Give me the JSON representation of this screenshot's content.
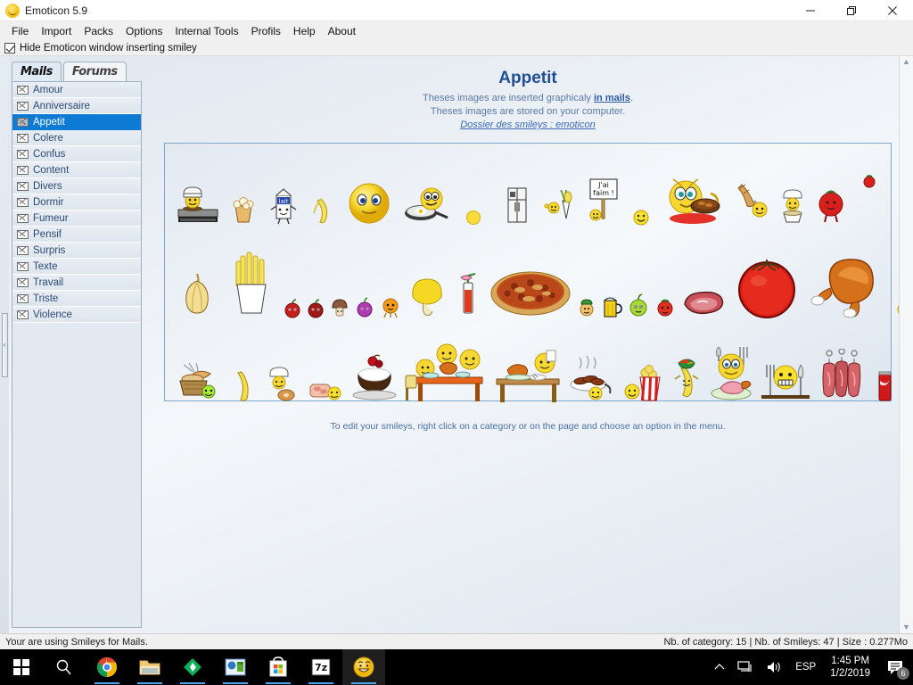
{
  "window": {
    "title": "Emoticon 5.9",
    "app_icon": "smiley-icon",
    "minimize_label": "Minimize",
    "restore_label": "Restore",
    "close_label": "Close"
  },
  "menu": {
    "items": [
      {
        "label": "File"
      },
      {
        "label": "Import"
      },
      {
        "label": "Packs"
      },
      {
        "label": "Options"
      },
      {
        "label": "Internal Tools"
      },
      {
        "label": "Profils"
      },
      {
        "label": "Help"
      },
      {
        "label": "About"
      }
    ]
  },
  "options_strip": {
    "hide_window_checkbox": {
      "label": "Hide Emoticon window inserting smiley",
      "checked": true
    }
  },
  "sidebar": {
    "collapse_handle": "‹",
    "tabs": [
      {
        "label": "Mails",
        "active": true
      },
      {
        "label": "Forums",
        "active": false
      }
    ],
    "categories": [
      {
        "label": "Amour",
        "icon": "envelope-icon",
        "selected": false
      },
      {
        "label": "Anniversaire",
        "icon": "envelope-icon",
        "selected": false
      },
      {
        "label": "Appetit",
        "icon": "envelope-icon",
        "selected": true
      },
      {
        "label": "Colere",
        "icon": "envelope-icon",
        "selected": false
      },
      {
        "label": "Confus",
        "icon": "envelope-icon",
        "selected": false
      },
      {
        "label": "Content",
        "icon": "envelope-icon",
        "selected": false
      },
      {
        "label": "Divers",
        "icon": "envelope-icon",
        "selected": false
      },
      {
        "label": "Dormir",
        "icon": "envelope-icon",
        "selected": false
      },
      {
        "label": "Fumeur",
        "icon": "envelope-icon",
        "selected": false
      },
      {
        "label": "Pensif",
        "icon": "envelope-icon",
        "selected": false
      },
      {
        "label": "Surpris",
        "icon": "envelope-icon",
        "selected": false
      },
      {
        "label": "Texte",
        "icon": "envelope-icon",
        "selected": false
      },
      {
        "label": "Travail",
        "icon": "envelope-icon",
        "selected": false
      },
      {
        "label": "Triste",
        "icon": "envelope-icon",
        "selected": false
      },
      {
        "label": "Violence",
        "icon": "envelope-icon",
        "selected": false
      }
    ]
  },
  "content": {
    "title": "Appetit",
    "line1_before": "Theses images are inserted graphicaly ",
    "line1_link": "in mails",
    "line1_after": ".",
    "line2": "Theses images are stored on your computer.",
    "folder_link": "Dossier des smileys : emoticon",
    "edit_hint": "To edit your smileys, right click on a category or on the page and choose an option in the menu.",
    "smiley_rows": [
      [
        {
          "name": "chef-grilling-smiley"
        },
        {
          "name": "popcorn-bag"
        },
        {
          "name": "milk-carton-character"
        },
        {
          "name": "peeled-banana"
        },
        {
          "name": "plain-yellow-smiley"
        },
        {
          "name": "frying-pan-egg-smiley"
        },
        {
          "name": "small-yellow-dot-smiley"
        },
        {
          "name": "refrigerator"
        },
        {
          "name": "vegetables-cone-smiley"
        },
        {
          "name": "jai-faim-sign",
          "caption": "J'ai\nfaim !"
        },
        {
          "name": "small-smiley-pair"
        },
        {
          "name": "smiley-eating-grill"
        },
        {
          "name": "baguette-ladle-smiley"
        },
        {
          "name": "chef-smiley-bowl"
        },
        {
          "name": "tomato-character"
        },
        {
          "name": "tiny-tomato"
        }
      ],
      [
        {
          "name": "garlic-bulb"
        },
        {
          "name": "french-fries"
        },
        {
          "name": "apple-face-red"
        },
        {
          "name": "apple-face-dark"
        },
        {
          "name": "mushroom-face"
        },
        {
          "name": "onion-face-purple"
        },
        {
          "name": "orange-face"
        },
        {
          "name": "big-mushroom"
        },
        {
          "name": "cocktail-drink"
        },
        {
          "name": "pizza"
        },
        {
          "name": "small-chef-smiley"
        },
        {
          "name": "beer-mug"
        },
        {
          "name": "green-apple-face"
        },
        {
          "name": "small-tomato-face"
        },
        {
          "name": "raw-steak"
        },
        {
          "name": "big-tomato"
        },
        {
          "name": "roast-turkey"
        },
        {
          "name": "smiley-with-napkin"
        }
      ],
      [
        {
          "name": "bread-basket-smiley"
        },
        {
          "name": "banana-slice"
        },
        {
          "name": "chef-donut-smiley"
        },
        {
          "name": "ham-slice-smiley"
        },
        {
          "name": "chocolate-cake-cherry"
        },
        {
          "name": "family-dinner-table"
        },
        {
          "name": "turkey-dinner-table"
        },
        {
          "name": "hot-sausages-plate"
        },
        {
          "name": "popcorn-bucket-smiley"
        },
        {
          "name": "banana-juggler"
        },
        {
          "name": "smiley-knife-fork"
        },
        {
          "name": "ham-platter"
        },
        {
          "name": "hungry-smiley-cutlery"
        },
        {
          "name": "meat-ribs"
        },
        {
          "name": "soda-can"
        }
      ]
    ]
  },
  "statusbar": {
    "left": "Your are using Smileys for Mails.",
    "right": "Nb. of category: 15 | Nb. of Smileys: 47 | Size : 0.277Mo"
  },
  "taskbar": {
    "items": [
      {
        "name": "start-button",
        "icon": "windows-logo-icon"
      },
      {
        "name": "search-button",
        "icon": "magnifier-icon"
      },
      {
        "name": "taskbar-chrome",
        "icon": "chrome-icon",
        "running": true
      },
      {
        "name": "taskbar-file-explorer",
        "icon": "folder-icon",
        "running": true
      },
      {
        "name": "taskbar-green-app",
        "icon": "green-diamond-icon",
        "running": true
      },
      {
        "name": "taskbar-blue-app",
        "icon": "blue-window-icon",
        "running": true
      },
      {
        "name": "taskbar-microsoft-store",
        "icon": "store-bag-icon",
        "running": true
      },
      {
        "name": "taskbar-7zip",
        "icon": "sevenzip-icon",
        "running": true
      },
      {
        "name": "taskbar-emoticon",
        "icon": "smiley-icon",
        "running": true,
        "active": true
      }
    ],
    "tray": {
      "show_hidden": "∧",
      "network_icon": "network-icon",
      "volume_icon": "speaker-icon",
      "language": "ESP",
      "time": "1:45 PM",
      "date": "1/2/2019",
      "notifications_icon": "speech-bubble-icon",
      "notifications_count": "6"
    }
  },
  "colors": {
    "selection_blue": "#0d7ad4",
    "title_blue": "#1f4e96",
    "link_blue": "#2a5ba8",
    "panel_border": "#7fa8cc",
    "taskbar_bg": "#000000"
  }
}
